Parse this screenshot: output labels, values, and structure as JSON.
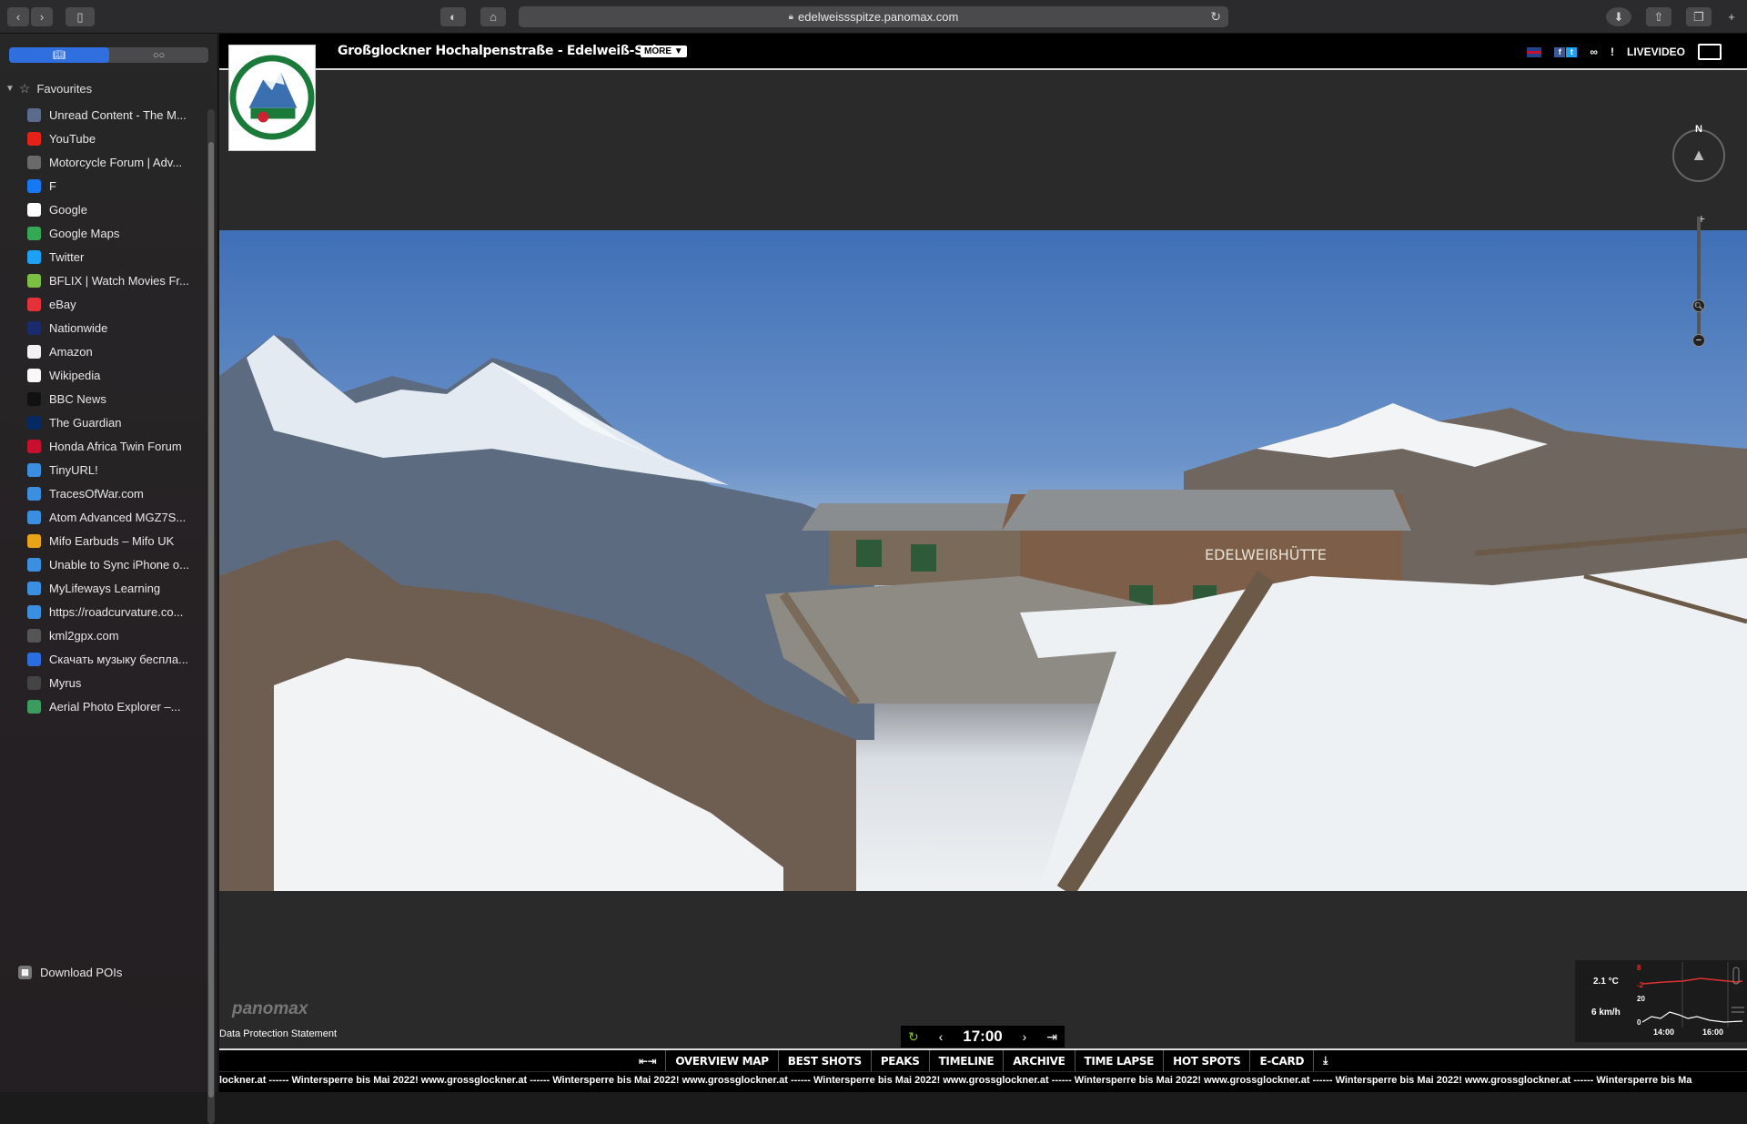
{
  "browser": {
    "url": "edelweissspitze.panomax.com"
  },
  "sidebar": {
    "tab_bookmarks_icon": "book-icon",
    "tab_reading_icon": "glasses-icon",
    "favourites_label": "Favourites",
    "items": [
      {
        "label": "Unread Content - The M...",
        "icon": "motorcycle-favicon",
        "color": "#5a6b8c"
      },
      {
        "label": "YouTube",
        "icon": "youtube-favicon",
        "color": "#e62117"
      },
      {
        "label": "Motorcycle Forum | Adv...",
        "icon": "forum-favicon",
        "color": "#6a6a6a"
      },
      {
        "label": "F",
        "icon": "facebook-favicon",
        "color": "#1877f2"
      },
      {
        "label": "Google",
        "icon": "google-favicon",
        "color": "#ffffff"
      },
      {
        "label": "Google Maps",
        "icon": "maps-favicon",
        "color": "#34a853"
      },
      {
        "label": "Twitter",
        "icon": "twitter-favicon",
        "color": "#1da1f2"
      },
      {
        "label": "BFLIX | Watch Movies Fr...",
        "icon": "bflix-favicon",
        "color": "#7bc043"
      },
      {
        "label": "eBay",
        "icon": "ebay-favicon",
        "color": "#e53238"
      },
      {
        "label": "Nationwide",
        "icon": "nationwide-favicon",
        "color": "#1a2b6d"
      },
      {
        "label": "Amazon",
        "icon": "amazon-favicon",
        "color": "#f2f2f2"
      },
      {
        "label": "Wikipedia",
        "icon": "wikipedia-favicon",
        "color": "#f8f8f8"
      },
      {
        "label": "BBC News",
        "icon": "bbc-favicon",
        "color": "#111111"
      },
      {
        "label": "The Guardian",
        "icon": "guardian-favicon",
        "color": "#052962"
      },
      {
        "label": "Honda Africa Twin Forum",
        "icon": "honda-favicon",
        "color": "#c8102e"
      },
      {
        "label": "TinyURL!",
        "icon": "globe-favicon",
        "color": "#3b8fe0"
      },
      {
        "label": "TracesOfWar.com",
        "icon": "globe-favicon",
        "color": "#3b8fe0"
      },
      {
        "label": "Atom Advanced MGZ7S...",
        "icon": "globe-favicon",
        "color": "#3b8fe0"
      },
      {
        "label": "Mifo Earbuds – Mifo UK",
        "icon": "mifo-favicon",
        "color": "#e8a317"
      },
      {
        "label": "Unable to Sync iPhone o...",
        "icon": "globe-favicon",
        "color": "#3b8fe0"
      },
      {
        "label": "MyLifeways Learning",
        "icon": "globe-favicon",
        "color": "#3b8fe0"
      },
      {
        "label": "https://roadcurvature.co...",
        "icon": "globe-favicon",
        "color": "#3b8fe0"
      },
      {
        "label": "kml2gpx.com",
        "icon": "kml-favicon",
        "color": "#555555"
      },
      {
        "label": "Скачать музыку бесплa...",
        "icon": "music-favicon",
        "color": "#2a6fe0"
      },
      {
        "label": "Myrus",
        "icon": "myrus-favicon",
        "color": "#444444"
      },
      {
        "label": "Aerial Photo Explorer –...",
        "icon": "aerial-favicon",
        "color": "#3a9d5d"
      }
    ],
    "download_label": "Download POIs"
  },
  "page": {
    "title": "Großglockner Hochalpenstraße - Edelweiß-Spitze",
    "more_label": "MORE",
    "livevideo_label": "LIVEVIDEO",
    "exclamation_label": "!",
    "compass_n": "N",
    "weather": {
      "temperature": "2.1 °C",
      "wind": "6 km/h",
      "chart_temp_top": "8",
      "chart_temp_bottom": "-2",
      "chart_wind_top": "20",
      "chart_wind_bottom": "0",
      "time_1": "14:00",
      "time_2": "16:00"
    },
    "panomax_logo": "panomax",
    "privacy_label": "Data Protection Statement",
    "current_time": "17:00",
    "nav": [
      "OVERVIEW MAP",
      "BEST SHOTS",
      "PEAKS",
      "TIMELINE",
      "ARCHIVE",
      "TIME LAPSE",
      "HOT SPOTS",
      "E-CARD"
    ],
    "ticker": "lockner.at ------ Wintersperre bis Mai 2022!  www.grossglockner.at ------ Wintersperre bis Mai 2022!  www.grossglockner.at ------ Wintersperre bis Mai 2022!  www.grossglockner.at ------ Wintersperre bis Mai 2022!  www.grossglockner.at ------ Wintersperre bis Mai 2022!  www.grossglockner.at ------ Wintersperre bis Ma",
    "hut_sign": "EDELWEIßHÜTTE",
    "logo_text_top": "GROSSGLOCKNER",
    "logo_text_bottom": "HOCHALPENSTRASSE"
  }
}
